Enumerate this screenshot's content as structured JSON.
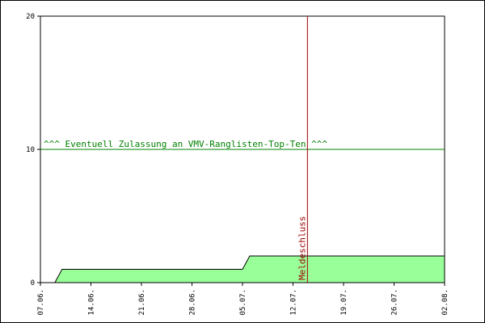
{
  "chart_data": {
    "type": "area",
    "title": "",
    "xlabel": "",
    "ylabel": "",
    "ylim": [
      0,
      20
    ],
    "yticks": [
      {
        "value": 0,
        "label": "0"
      },
      {
        "value": 10,
        "label": "10"
      },
      {
        "value": 20,
        "label": "20"
      }
    ],
    "xlim": [
      "07.06.",
      "02.08."
    ],
    "xticks": [
      "07.06.",
      "14.06.",
      "21.06.",
      "28.06.",
      "05.07.",
      "12.07.",
      "19.07.",
      "26.07.",
      "02.08."
    ],
    "grid": false,
    "series": [
      {
        "x": [
          "07.06.",
          "09.06.",
          "10.06.",
          "05.07.",
          "06.07.",
          "02.08."
        ],
        "y": [
          0,
          0,
          1,
          1,
          2,
          2
        ],
        "fill": "#99ff99",
        "stroke": "#000000"
      }
    ],
    "annotations": [
      {
        "type": "hline",
        "value": 10,
        "label": "^^^ Eventuell Zulassung an VMV-Ranglisten-Top-Ten ^^^",
        "color": "#008000"
      },
      {
        "type": "vline",
        "at": "14.07.",
        "label": "Meldeschluss",
        "color": "#a00000"
      }
    ]
  }
}
